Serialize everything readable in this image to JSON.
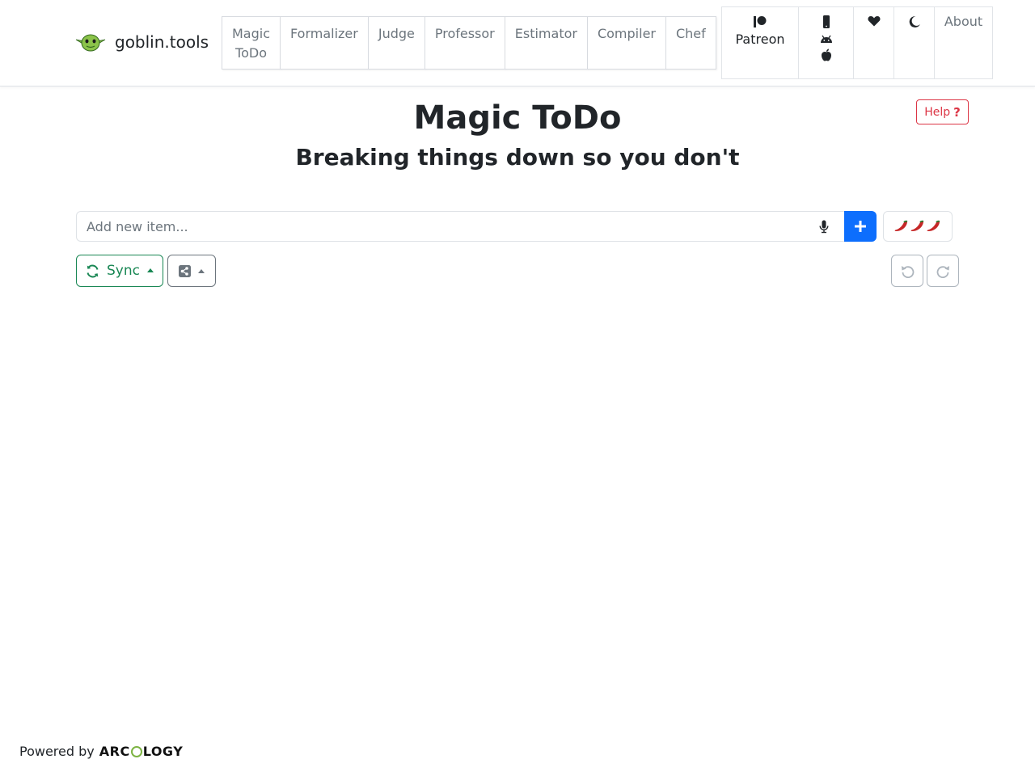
{
  "brand": {
    "name": "goblin.tools"
  },
  "nav": {
    "tabs": [
      {
        "line1": "Magic",
        "line2": "ToDo"
      },
      {
        "line1": "Formalizer",
        "line2": ""
      },
      {
        "line1": "Judge",
        "line2": ""
      },
      {
        "line1": "Professor",
        "line2": ""
      },
      {
        "line1": "Estimator",
        "line2": ""
      },
      {
        "line1": "Compiler",
        "line2": ""
      },
      {
        "line1": "Chef",
        "line2": ""
      }
    ],
    "patreon_label": "Patreon",
    "about_label": "About"
  },
  "main": {
    "title": "Magic ToDo",
    "subtitle": "Breaking things down so you don't",
    "help_label": "Help",
    "help_icon": "?",
    "input_placeholder": "Add new item...",
    "sync_label": "Sync"
  },
  "footer": {
    "powered_by": "Powered by",
    "logo_part1": "ARC",
    "logo_part2": "LOGY"
  },
  "colors": {
    "primary": "#0d6efd",
    "success": "#198754",
    "danger": "#dc3545",
    "secondary": "#6c757d",
    "goblin_green": "#8bc34a"
  },
  "icons": [
    "goblin-logo-icon",
    "patreon-icon",
    "mobile-icon",
    "android-icon",
    "apple-icon",
    "heart-icon",
    "moon-icon",
    "microphone-icon",
    "plus-icon",
    "chili-pepper-icon",
    "sync-icon",
    "share-icon",
    "undo-icon",
    "redo-icon"
  ]
}
